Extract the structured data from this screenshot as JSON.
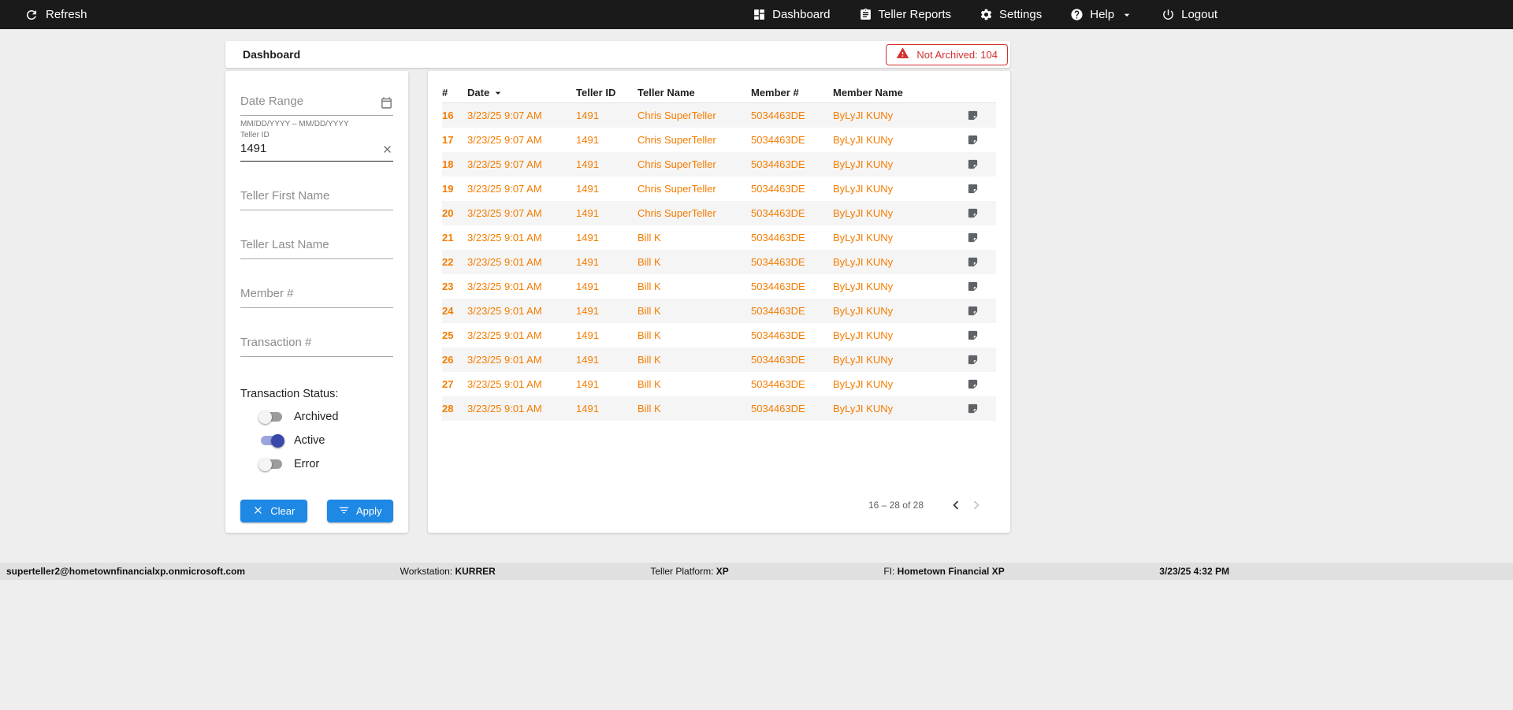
{
  "colors": {
    "topbar_bg": "#1a1a1a",
    "accent_blue": "#1e88e5",
    "toggle_on": "#3949ab",
    "orange": "#f57c00",
    "error_red": "#d32f2f"
  },
  "topbar": {
    "refresh_label": "Refresh",
    "nav": [
      {
        "label": "Dashboard",
        "icon": "dashboard-icon"
      },
      {
        "label": "Teller Reports",
        "icon": "reports-icon"
      },
      {
        "label": "Settings",
        "icon": "gear-icon"
      },
      {
        "label": "Help",
        "icon": "help-icon"
      },
      {
        "label": "Logout",
        "icon": "power-icon"
      }
    ]
  },
  "header": {
    "title": "Dashboard",
    "alert": "Not Archived: 104"
  },
  "filters": {
    "date_range_placeholder": "Date Range",
    "date_range_hint": "MM/DD/YYYY – MM/DD/YYYY",
    "teller_id_label": "Teller ID",
    "teller_id_value": "1491",
    "teller_first_name_placeholder": "Teller First Name",
    "teller_last_name_placeholder": "Teller Last Name",
    "member_number_placeholder": "Member #",
    "transaction_number_placeholder": "Transaction #",
    "status_label": "Transaction Status:",
    "toggles": [
      {
        "label": "Archived",
        "on": false
      },
      {
        "label": "Active",
        "on": true
      },
      {
        "label": "Error",
        "on": false
      }
    ],
    "clear_label": "Clear",
    "apply_label": "Apply"
  },
  "table": {
    "columns": [
      "#",
      "Date",
      "Teller ID",
      "Teller Name",
      "Member #",
      "Member Name"
    ],
    "rows": [
      {
        "num": "16",
        "date": "3/23/25 9:07 AM",
        "teller_id": "1491",
        "teller_name": "Chris SuperTeller",
        "member_num": "5034463DE",
        "member_name": "ByLyJI KUNy"
      },
      {
        "num": "17",
        "date": "3/23/25 9:07 AM",
        "teller_id": "1491",
        "teller_name": "Chris SuperTeller",
        "member_num": "5034463DE",
        "member_name": "ByLyJI KUNy"
      },
      {
        "num": "18",
        "date": "3/23/25 9:07 AM",
        "teller_id": "1491",
        "teller_name": "Chris SuperTeller",
        "member_num": "5034463DE",
        "member_name": "ByLyJI KUNy"
      },
      {
        "num": "19",
        "date": "3/23/25 9:07 AM",
        "teller_id": "1491",
        "teller_name": "Chris SuperTeller",
        "member_num": "5034463DE",
        "member_name": "ByLyJI KUNy"
      },
      {
        "num": "20",
        "date": "3/23/25 9:07 AM",
        "teller_id": "1491",
        "teller_name": "Chris SuperTeller",
        "member_num": "5034463DE",
        "member_name": "ByLyJI KUNy"
      },
      {
        "num": "21",
        "date": "3/23/25 9:01 AM",
        "teller_id": "1491",
        "teller_name": "Bill K",
        "member_num": "5034463DE",
        "member_name": "ByLyJI KUNy"
      },
      {
        "num": "22",
        "date": "3/23/25 9:01 AM",
        "teller_id": "1491",
        "teller_name": "Bill K",
        "member_num": "5034463DE",
        "member_name": "ByLyJI KUNy"
      },
      {
        "num": "23",
        "date": "3/23/25 9:01 AM",
        "teller_id": "1491",
        "teller_name": "Bill K",
        "member_num": "5034463DE",
        "member_name": "ByLyJI KUNy"
      },
      {
        "num": "24",
        "date": "3/23/25 9:01 AM",
        "teller_id": "1491",
        "teller_name": "Bill K",
        "member_num": "5034463DE",
        "member_name": "ByLyJI KUNy"
      },
      {
        "num": "25",
        "date": "3/23/25 9:01 AM",
        "teller_id": "1491",
        "teller_name": "Bill K",
        "member_num": "5034463DE",
        "member_name": "ByLyJI KUNy"
      },
      {
        "num": "26",
        "date": "3/23/25 9:01 AM",
        "teller_id": "1491",
        "teller_name": "Bill K",
        "member_num": "5034463DE",
        "member_name": "ByLyJI KUNy"
      },
      {
        "num": "27",
        "date": "3/23/25 9:01 AM",
        "teller_id": "1491",
        "teller_name": "Bill K",
        "member_num": "5034463DE",
        "member_name": "ByLyJI KUNy"
      },
      {
        "num": "28",
        "date": "3/23/25 9:01 AM",
        "teller_id": "1491",
        "teller_name": "Bill K",
        "member_num": "5034463DE",
        "member_name": "ByLyJI KUNy"
      }
    ],
    "pagination": {
      "label": "16 – 28 of 28"
    }
  },
  "footer": {
    "email": "superteller2@hometownfinancialxp.onmicrosoft.com",
    "workstation_label": "Workstation:",
    "workstation_value": "KURRER",
    "platform_label": "Teller Platform:",
    "platform_value": "XP",
    "fi_label": "FI:",
    "fi_value": "Hometown Financial XP",
    "datetime": "3/23/25 4:32 PM"
  }
}
